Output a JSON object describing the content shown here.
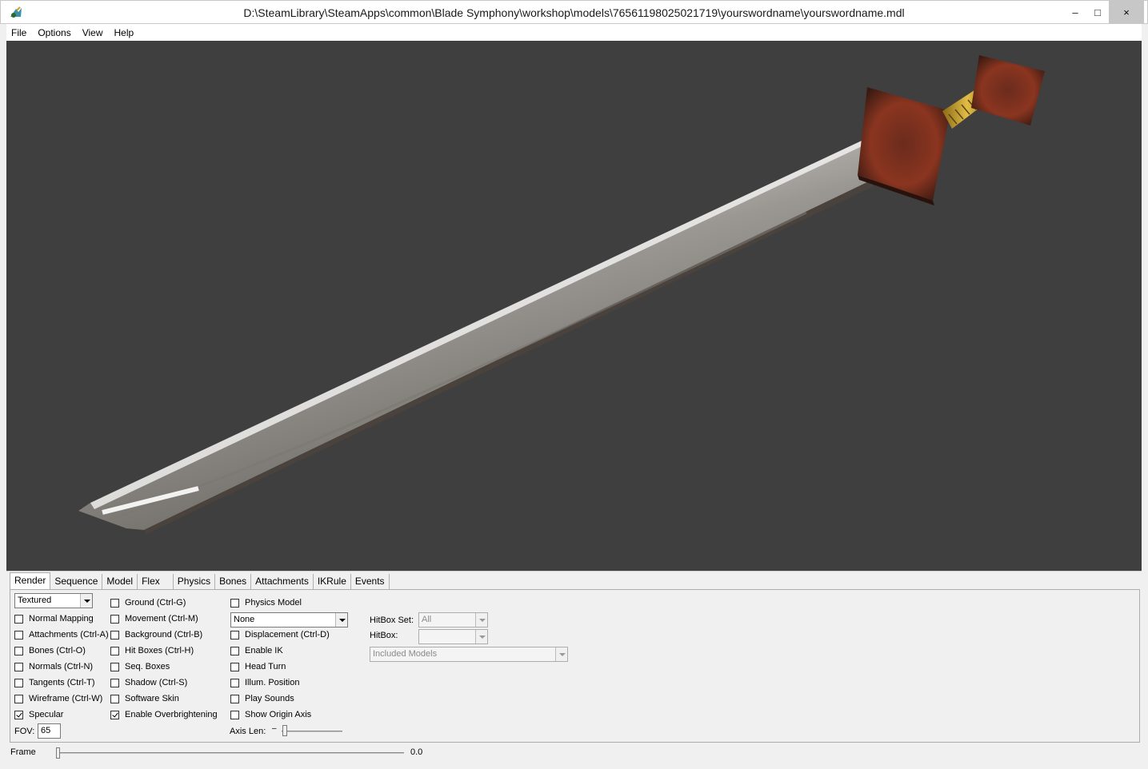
{
  "window": {
    "title": "D:\\SteamLibrary\\SteamApps\\common\\Blade Symphony\\workshop\\models\\76561198025021719\\yourswordname\\yourswordname.mdl",
    "minimize": "–",
    "maximize": "□",
    "close": "×"
  },
  "menu": [
    "File",
    "Options",
    "View",
    "Help"
  ],
  "tabs": [
    "Render",
    "Sequence",
    "Model",
    "Flex",
    "Physics",
    "Bones",
    "Attachments",
    "IKRule",
    "Events"
  ],
  "render": {
    "render_mode": "Textured",
    "col1": [
      {
        "label": "Normal Mapping",
        "checked": false
      },
      {
        "label": "Attachments (Ctrl-A)",
        "checked": false
      },
      {
        "label": "Bones (Ctrl-O)",
        "checked": false
      },
      {
        "label": "Normals (Ctrl-N)",
        "checked": false
      },
      {
        "label": "Tangents (Ctrl-T)",
        "checked": false
      },
      {
        "label": "Wireframe (Ctrl-W)",
        "checked": false
      },
      {
        "label": "Specular",
        "checked": true
      }
    ],
    "col2": [
      {
        "label": "Ground (Ctrl-G)",
        "checked": false
      },
      {
        "label": "Movement (Ctrl-M)",
        "checked": false
      },
      {
        "label": "Background (Ctrl-B)",
        "checked": false
      },
      {
        "label": "Hit Boxes (Ctrl-H)",
        "checked": false
      },
      {
        "label": "Seq. Boxes",
        "checked": false
      },
      {
        "label": "Shadow (Ctrl-S)",
        "checked": false
      },
      {
        "label": "Software Skin",
        "checked": false
      },
      {
        "label": "Enable Overbrightening",
        "checked": true
      }
    ],
    "physics_model": {
      "label": "Physics Model",
      "checked": false
    },
    "physics_combo": "None",
    "col3": [
      {
        "label": "Displacement (Ctrl-D)",
        "checked": false
      },
      {
        "label": "Enable IK",
        "checked": false
      },
      {
        "label": "Head Turn",
        "checked": false
      },
      {
        "label": "Illum. Position",
        "checked": false
      },
      {
        "label": "Play Sounds",
        "checked": false
      },
      {
        "label": "Show Origin Axis",
        "checked": false
      }
    ],
    "fov_label": "FOV:",
    "fov_value": "65",
    "axis_len_label": "Axis Len:",
    "hitbox_set_label": "HitBox Set:",
    "hitbox_set_value": "All",
    "hitbox_label": "HitBox:",
    "hitbox_value": "",
    "included_models": "Included Models"
  },
  "frame": {
    "label": "Frame",
    "value": "0.0",
    "position": 0
  },
  "colors": {
    "viewport_bg": "#3f3f3f",
    "blade": "#b9b6b2",
    "guard": "#7a2e1c",
    "handle": "#c9a534"
  },
  "icons": {
    "app": "hlmv-app-icon",
    "minimize": "minimize-icon",
    "maximize": "maximize-icon",
    "close": "close-icon"
  }
}
